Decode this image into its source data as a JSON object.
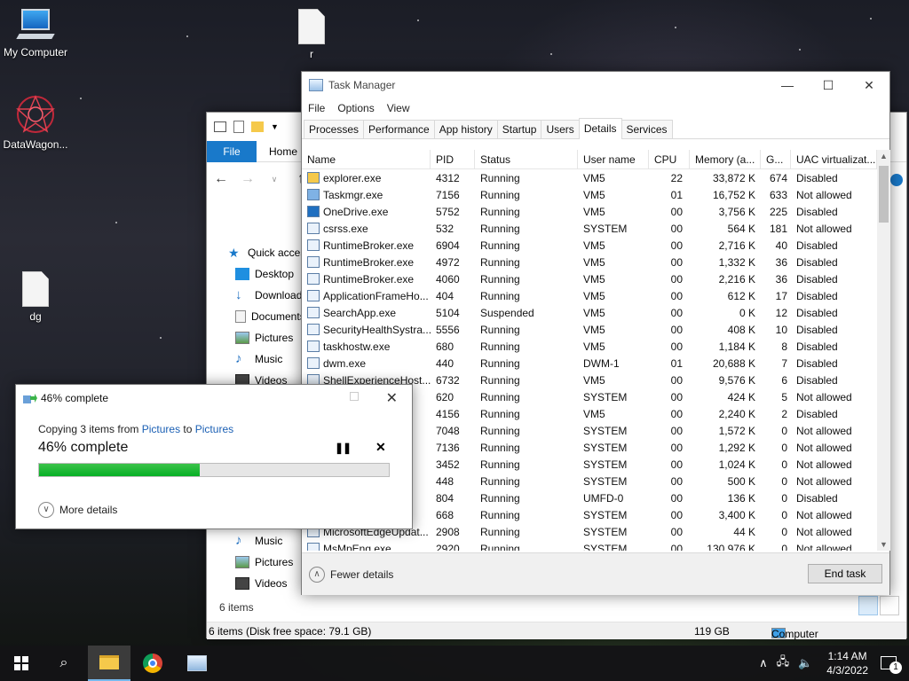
{
  "desktop": {
    "icons": [
      {
        "label": "My Computer",
        "icon": "computer-icon"
      },
      {
        "label": "DataWagon...",
        "icon": "datawagon-icon"
      },
      {
        "label": "r",
        "icon": "file-icon"
      },
      {
        "label": "dg",
        "icon": "file-icon"
      }
    ]
  },
  "explorer": {
    "file_tab": "File",
    "home_tab": "Home",
    "nav": [
      {
        "label": "Quick access",
        "icon": "star-icon"
      },
      {
        "label": "Desktop",
        "icon": "desktop-icon"
      },
      {
        "label": "Downloads",
        "icon": "download-icon"
      },
      {
        "label": "Documents",
        "icon": "document-icon"
      },
      {
        "label": "Pictures",
        "icon": "pictures-icon"
      },
      {
        "label": "Music",
        "icon": "music-icon"
      },
      {
        "label": "Videos",
        "icon": "videos-icon"
      }
    ],
    "nav_lower": [
      {
        "label": "Music",
        "icon": "music-icon"
      },
      {
        "label": "Pictures",
        "icon": "pictures-icon"
      },
      {
        "label": "Videos",
        "icon": "videos-icon"
      }
    ],
    "items_count": "6 items",
    "status_left": "6 items (Disk free space: 79.1 GB)",
    "status_size": "119 GB",
    "status_location": "Computer"
  },
  "taskmgr": {
    "title": "Task Manager",
    "menu": [
      "File",
      "Options",
      "View"
    ],
    "tabs": [
      "Processes",
      "Performance",
      "App history",
      "Startup",
      "Users",
      "Details",
      "Services"
    ],
    "active_tab": "Details",
    "columns": [
      "Name",
      "PID",
      "Status",
      "User name",
      "CPU",
      "Memory (a...",
      "G...",
      "UAC virtualizat..."
    ],
    "rows": [
      {
        "name": "explorer.exe",
        "pid": "4312",
        "status": "Running",
        "user": "VM5",
        "cpu": "22",
        "mem": "33,872 K",
        "g": "674",
        "uac": "Disabled"
      },
      {
        "name": "Taskmgr.exe",
        "pid": "7156",
        "status": "Running",
        "user": "VM5",
        "cpu": "01",
        "mem": "16,752 K",
        "g": "633",
        "uac": "Not allowed"
      },
      {
        "name": "OneDrive.exe",
        "pid": "5752",
        "status": "Running",
        "user": "VM5",
        "cpu": "00",
        "mem": "3,756 K",
        "g": "225",
        "uac": "Disabled"
      },
      {
        "name": "csrss.exe",
        "pid": "532",
        "status": "Running",
        "user": "SYSTEM",
        "cpu": "00",
        "mem": "564 K",
        "g": "181",
        "uac": "Not allowed"
      },
      {
        "name": "RuntimeBroker.exe",
        "pid": "6904",
        "status": "Running",
        "user": "VM5",
        "cpu": "00",
        "mem": "2,716 K",
        "g": "40",
        "uac": "Disabled"
      },
      {
        "name": "RuntimeBroker.exe",
        "pid": "4972",
        "status": "Running",
        "user": "VM5",
        "cpu": "00",
        "mem": "1,332 K",
        "g": "36",
        "uac": "Disabled"
      },
      {
        "name": "RuntimeBroker.exe",
        "pid": "4060",
        "status": "Running",
        "user": "VM5",
        "cpu": "00",
        "mem": "2,216 K",
        "g": "36",
        "uac": "Disabled"
      },
      {
        "name": "ApplicationFrameHo...",
        "pid": "404",
        "status": "Running",
        "user": "VM5",
        "cpu": "00",
        "mem": "612 K",
        "g": "17",
        "uac": "Disabled"
      },
      {
        "name": "SearchApp.exe",
        "pid": "5104",
        "status": "Suspended",
        "user": "VM5",
        "cpu": "00",
        "mem": "0 K",
        "g": "12",
        "uac": "Disabled"
      },
      {
        "name": "SecurityHealthSystra...",
        "pid": "5556",
        "status": "Running",
        "user": "VM5",
        "cpu": "00",
        "mem": "408 K",
        "g": "10",
        "uac": "Disabled"
      },
      {
        "name": "taskhostw.exe",
        "pid": "680",
        "status": "Running",
        "user": "VM5",
        "cpu": "00",
        "mem": "1,184 K",
        "g": "8",
        "uac": "Disabled"
      },
      {
        "name": "dwm.exe",
        "pid": "440",
        "status": "Running",
        "user": "DWM-1",
        "cpu": "01",
        "mem": "20,688 K",
        "g": "7",
        "uac": "Disabled"
      },
      {
        "name": "ShellExperienceHost...",
        "pid": "6732",
        "status": "Running",
        "user": "VM5",
        "cpu": "00",
        "mem": "9,576 K",
        "g": "6",
        "uac": "Disabled"
      },
      {
        "name": "",
        "pid": "620",
        "status": "Running",
        "user": "SYSTEM",
        "cpu": "00",
        "mem": "424 K",
        "g": "5",
        "uac": "Not allowed"
      },
      {
        "name": "",
        "pid": "4156",
        "status": "Running",
        "user": "VM5",
        "cpu": "00",
        "mem": "2,240 K",
        "g": "2",
        "uac": "Disabled"
      },
      {
        "name": "",
        "pid": "7048",
        "status": "Running",
        "user": "SYSTEM",
        "cpu": "00",
        "mem": "1,572 K",
        "g": "0",
        "uac": "Not allowed"
      },
      {
        "name": "",
        "pid": "7136",
        "status": "Running",
        "user": "SYSTEM",
        "cpu": "00",
        "mem": "1,292 K",
        "g": "0",
        "uac": "Not allowed"
      },
      {
        "name": "",
        "pid": "3452",
        "status": "Running",
        "user": "SYSTEM",
        "cpu": "00",
        "mem": "1,024 K",
        "g": "0",
        "uac": "Not allowed"
      },
      {
        "name": "",
        "pid": "448",
        "status": "Running",
        "user": "SYSTEM",
        "cpu": "00",
        "mem": "500 K",
        "g": "0",
        "uac": "Not allowed"
      },
      {
        "name": "",
        "pid": "804",
        "status": "Running",
        "user": "UMFD-0",
        "cpu": "00",
        "mem": "136 K",
        "g": "0",
        "uac": "Disabled"
      },
      {
        "name": "",
        "pid": "668",
        "status": "Running",
        "user": "SYSTEM",
        "cpu": "00",
        "mem": "3,400 K",
        "g": "0",
        "uac": "Not allowed"
      },
      {
        "name": "MicrosoftEdgeUpdat...",
        "pid": "2908",
        "status": "Running",
        "user": "SYSTEM",
        "cpu": "00",
        "mem": "44 K",
        "g": "0",
        "uac": "Not allowed"
      },
      {
        "name": "MsMpEng.exe",
        "pid": "2920",
        "status": "Running",
        "user": "SYSTEM",
        "cpu": "00",
        "mem": "130,976 K",
        "g": "0",
        "uac": "Not allowed"
      }
    ],
    "fewer_details": "Fewer details",
    "end_task": "End task"
  },
  "copy_dialog": {
    "title": "46% complete",
    "line_prefix": "Copying 3 items from ",
    "from": "Pictures",
    "to_word": " to ",
    "to": "Pictures",
    "progress_text": "46% complete",
    "progress": 0.46,
    "more_details": "More details"
  },
  "taskbar": {
    "time": "1:14 AM",
    "date": "4/3/2022",
    "notifications": "1"
  },
  "colors": {
    "accent": "#1979ca",
    "progress": "#06b025",
    "link": "#1a5fb4"
  }
}
